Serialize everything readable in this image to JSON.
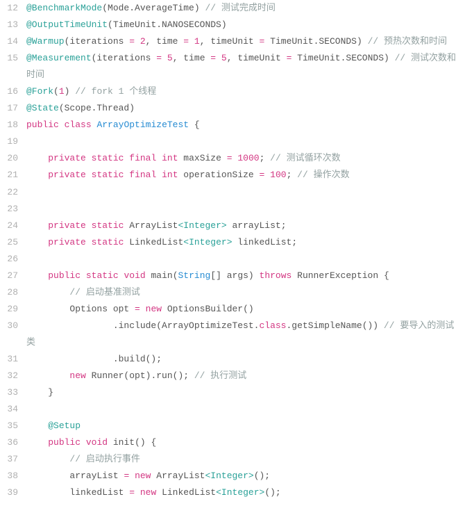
{
  "lines": [
    {
      "num": 12,
      "segments": [
        {
          "cls": "tok-ann",
          "t": "@BenchmarkMode"
        },
        {
          "cls": "tok-plain",
          "t": "(Mode.AverageTime) "
        },
        {
          "cls": "tok-cmt",
          "t": "// 测试完成时间"
        }
      ]
    },
    {
      "num": 13,
      "segments": [
        {
          "cls": "tok-ann",
          "t": "@OutputTimeUnit"
        },
        {
          "cls": "tok-plain",
          "t": "(TimeUnit.NANOSECONDS)"
        }
      ]
    },
    {
      "num": 14,
      "segments": [
        {
          "cls": "tok-ann",
          "t": "@Warmup"
        },
        {
          "cls": "tok-plain",
          "t": "(iterations "
        },
        {
          "cls": "tok-op",
          "t": "="
        },
        {
          "cls": "tok-plain",
          "t": " "
        },
        {
          "cls": "tok-num",
          "t": "2"
        },
        {
          "cls": "tok-plain",
          "t": ", time "
        },
        {
          "cls": "tok-op",
          "t": "="
        },
        {
          "cls": "tok-plain",
          "t": " "
        },
        {
          "cls": "tok-num",
          "t": "1"
        },
        {
          "cls": "tok-plain",
          "t": ", timeUnit "
        },
        {
          "cls": "tok-op",
          "t": "="
        },
        {
          "cls": "tok-plain",
          "t": " TimeUnit.SECONDS) "
        },
        {
          "cls": "tok-cmt",
          "t": "// 预热次数和时间"
        }
      ]
    },
    {
      "num": 15,
      "segments": [
        {
          "cls": "tok-ann",
          "t": "@Measurement"
        },
        {
          "cls": "tok-plain",
          "t": "(iterations "
        },
        {
          "cls": "tok-op",
          "t": "="
        },
        {
          "cls": "tok-plain",
          "t": " "
        },
        {
          "cls": "tok-num",
          "t": "5"
        },
        {
          "cls": "tok-plain",
          "t": ", time "
        },
        {
          "cls": "tok-op",
          "t": "="
        },
        {
          "cls": "tok-plain",
          "t": " "
        },
        {
          "cls": "tok-num",
          "t": "5"
        },
        {
          "cls": "tok-plain",
          "t": ", timeUnit "
        },
        {
          "cls": "tok-op",
          "t": "="
        },
        {
          "cls": "tok-plain",
          "t": " TimeUnit.SECONDS) "
        },
        {
          "cls": "tok-cmt",
          "t": "// 测试次数和时间"
        }
      ]
    },
    {
      "num": 16,
      "segments": [
        {
          "cls": "tok-ann",
          "t": "@Fork"
        },
        {
          "cls": "tok-plain",
          "t": "("
        },
        {
          "cls": "tok-num",
          "t": "1"
        },
        {
          "cls": "tok-plain",
          "t": ") "
        },
        {
          "cls": "tok-cmt",
          "t": "// fork 1 个线程"
        }
      ]
    },
    {
      "num": 17,
      "segments": [
        {
          "cls": "tok-ann",
          "t": "@State"
        },
        {
          "cls": "tok-plain",
          "t": "(Scope.Thread)"
        }
      ]
    },
    {
      "num": 18,
      "segments": [
        {
          "cls": "tok-kw",
          "t": "public"
        },
        {
          "cls": "tok-plain",
          "t": " "
        },
        {
          "cls": "tok-kw",
          "t": "class"
        },
        {
          "cls": "tok-plain",
          "t": " "
        },
        {
          "cls": "tok-type",
          "t": "ArrayOptimizeTest"
        },
        {
          "cls": "tok-plain",
          "t": " {"
        }
      ]
    },
    {
      "num": 19,
      "segments": [
        {
          "cls": "tok-plain",
          "t": ""
        }
      ]
    },
    {
      "num": 20,
      "segments": [
        {
          "cls": "tok-plain",
          "t": "    "
        },
        {
          "cls": "tok-kw",
          "t": "private"
        },
        {
          "cls": "tok-plain",
          "t": " "
        },
        {
          "cls": "tok-kw",
          "t": "static"
        },
        {
          "cls": "tok-plain",
          "t": " "
        },
        {
          "cls": "tok-kw",
          "t": "final"
        },
        {
          "cls": "tok-plain",
          "t": " "
        },
        {
          "cls": "tok-kw",
          "t": "int"
        },
        {
          "cls": "tok-plain",
          "t": " maxSize "
        },
        {
          "cls": "tok-op",
          "t": "="
        },
        {
          "cls": "tok-plain",
          "t": " "
        },
        {
          "cls": "tok-num",
          "t": "1000"
        },
        {
          "cls": "tok-plain",
          "t": "; "
        },
        {
          "cls": "tok-cmt",
          "t": "// 测试循环次数"
        }
      ]
    },
    {
      "num": 21,
      "segments": [
        {
          "cls": "tok-plain",
          "t": "    "
        },
        {
          "cls": "tok-kw",
          "t": "private"
        },
        {
          "cls": "tok-plain",
          "t": " "
        },
        {
          "cls": "tok-kw",
          "t": "static"
        },
        {
          "cls": "tok-plain",
          "t": " "
        },
        {
          "cls": "tok-kw",
          "t": "final"
        },
        {
          "cls": "tok-plain",
          "t": " "
        },
        {
          "cls": "tok-kw",
          "t": "int"
        },
        {
          "cls": "tok-plain",
          "t": " operationSize "
        },
        {
          "cls": "tok-op",
          "t": "="
        },
        {
          "cls": "tok-plain",
          "t": " "
        },
        {
          "cls": "tok-num",
          "t": "100"
        },
        {
          "cls": "tok-plain",
          "t": "; "
        },
        {
          "cls": "tok-cmt",
          "t": "// 操作次数"
        }
      ]
    },
    {
      "num": 22,
      "segments": [
        {
          "cls": "tok-plain",
          "t": ""
        }
      ]
    },
    {
      "num": 23,
      "segments": [
        {
          "cls": "tok-plain",
          "t": ""
        }
      ]
    },
    {
      "num": 24,
      "segments": [
        {
          "cls": "tok-plain",
          "t": "    "
        },
        {
          "cls": "tok-kw",
          "t": "private"
        },
        {
          "cls": "tok-plain",
          "t": " "
        },
        {
          "cls": "tok-kw",
          "t": "static"
        },
        {
          "cls": "tok-plain",
          "t": " ArrayList"
        },
        {
          "cls": "tok-gentype",
          "t": "<Integer>"
        },
        {
          "cls": "tok-plain",
          "t": " arrayList;"
        }
      ]
    },
    {
      "num": 25,
      "segments": [
        {
          "cls": "tok-plain",
          "t": "    "
        },
        {
          "cls": "tok-kw",
          "t": "private"
        },
        {
          "cls": "tok-plain",
          "t": " "
        },
        {
          "cls": "tok-kw",
          "t": "static"
        },
        {
          "cls": "tok-plain",
          "t": " LinkedList"
        },
        {
          "cls": "tok-gentype",
          "t": "<Integer>"
        },
        {
          "cls": "tok-plain",
          "t": " linkedList;"
        }
      ]
    },
    {
      "num": 26,
      "segments": [
        {
          "cls": "tok-plain",
          "t": ""
        }
      ]
    },
    {
      "num": 27,
      "segments": [
        {
          "cls": "tok-plain",
          "t": "    "
        },
        {
          "cls": "tok-kw",
          "t": "public"
        },
        {
          "cls": "tok-plain",
          "t": " "
        },
        {
          "cls": "tok-kw",
          "t": "static"
        },
        {
          "cls": "tok-plain",
          "t": " "
        },
        {
          "cls": "tok-kw",
          "t": "void"
        },
        {
          "cls": "tok-plain",
          "t": " main("
        },
        {
          "cls": "tok-type",
          "t": "String"
        },
        {
          "cls": "tok-plain",
          "t": "[] args) "
        },
        {
          "cls": "tok-kw",
          "t": "throws"
        },
        {
          "cls": "tok-plain",
          "t": " RunnerException {"
        }
      ]
    },
    {
      "num": 28,
      "segments": [
        {
          "cls": "tok-plain",
          "t": "        "
        },
        {
          "cls": "tok-cmt",
          "t": "// 启动基准测试"
        }
      ]
    },
    {
      "num": 29,
      "segments": [
        {
          "cls": "tok-plain",
          "t": "        Options opt "
        },
        {
          "cls": "tok-op",
          "t": "="
        },
        {
          "cls": "tok-plain",
          "t": " "
        },
        {
          "cls": "tok-kw",
          "t": "new"
        },
        {
          "cls": "tok-plain",
          "t": " OptionsBuilder()"
        }
      ]
    },
    {
      "num": 30,
      "segments": [
        {
          "cls": "tok-plain",
          "t": "                .include(ArrayOptimizeTest."
        },
        {
          "cls": "tok-kw",
          "t": "class"
        },
        {
          "cls": "tok-plain",
          "t": ".getSimpleName()) "
        },
        {
          "cls": "tok-cmt",
          "t": "// 要导入的测试类"
        }
      ]
    },
    {
      "num": 31,
      "segments": [
        {
          "cls": "tok-plain",
          "t": "                .build();"
        }
      ]
    },
    {
      "num": 32,
      "segments": [
        {
          "cls": "tok-plain",
          "t": "        "
        },
        {
          "cls": "tok-kw",
          "t": "new"
        },
        {
          "cls": "tok-plain",
          "t": " Runner(opt).run(); "
        },
        {
          "cls": "tok-cmt",
          "t": "// 执行测试"
        }
      ]
    },
    {
      "num": 33,
      "segments": [
        {
          "cls": "tok-plain",
          "t": "    }"
        }
      ]
    },
    {
      "num": 34,
      "segments": [
        {
          "cls": "tok-plain",
          "t": ""
        }
      ]
    },
    {
      "num": 35,
      "segments": [
        {
          "cls": "tok-plain",
          "t": "    "
        },
        {
          "cls": "tok-ann",
          "t": "@Setup"
        }
      ]
    },
    {
      "num": 36,
      "segments": [
        {
          "cls": "tok-plain",
          "t": "    "
        },
        {
          "cls": "tok-kw",
          "t": "public"
        },
        {
          "cls": "tok-plain",
          "t": " "
        },
        {
          "cls": "tok-kw",
          "t": "void"
        },
        {
          "cls": "tok-plain",
          "t": " init() {"
        }
      ]
    },
    {
      "num": 37,
      "segments": [
        {
          "cls": "tok-plain",
          "t": "        "
        },
        {
          "cls": "tok-cmt",
          "t": "// 启动执行事件"
        }
      ]
    },
    {
      "num": 38,
      "segments": [
        {
          "cls": "tok-plain",
          "t": "        arrayList "
        },
        {
          "cls": "tok-op",
          "t": "="
        },
        {
          "cls": "tok-plain",
          "t": " "
        },
        {
          "cls": "tok-kw",
          "t": "new"
        },
        {
          "cls": "tok-plain",
          "t": " ArrayList"
        },
        {
          "cls": "tok-gentype",
          "t": "<Integer>"
        },
        {
          "cls": "tok-plain",
          "t": "();"
        }
      ]
    },
    {
      "num": 39,
      "segments": [
        {
          "cls": "tok-plain",
          "t": "        linkedList "
        },
        {
          "cls": "tok-op",
          "t": "="
        },
        {
          "cls": "tok-plain",
          "t": " "
        },
        {
          "cls": "tok-kw",
          "t": "new"
        },
        {
          "cls": "tok-plain",
          "t": " LinkedList"
        },
        {
          "cls": "tok-gentype",
          "t": "<Integer>"
        },
        {
          "cls": "tok-plain",
          "t": "();"
        }
      ]
    }
  ]
}
